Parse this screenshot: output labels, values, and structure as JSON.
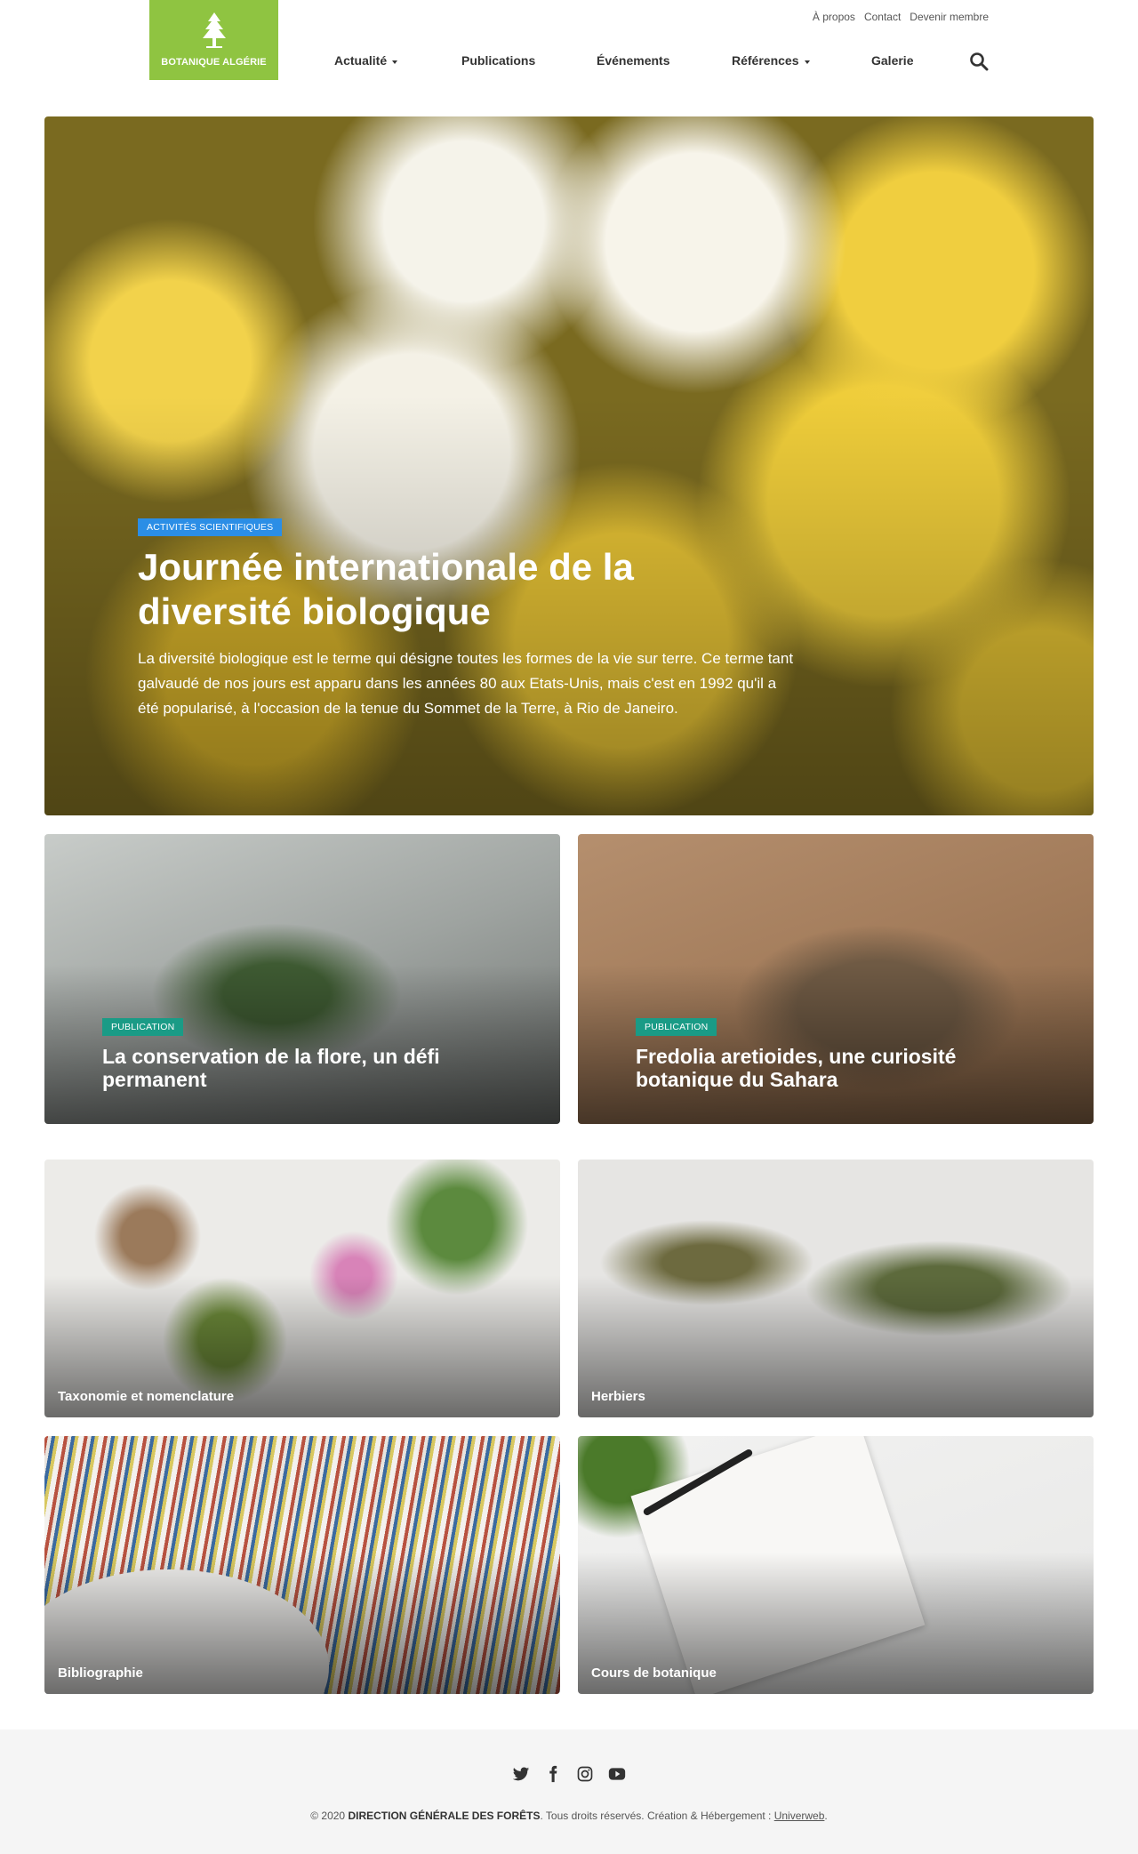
{
  "header": {
    "logo_text": "BOTANIQUE ALGÉRIE",
    "top_links": [
      "À propos",
      "Contact",
      "Devenir membre"
    ],
    "nav": [
      {
        "label": "Actualité",
        "dropdown": true
      },
      {
        "label": "Publications",
        "dropdown": false
      },
      {
        "label": "Événements",
        "dropdown": false
      },
      {
        "label": "Références",
        "dropdown": true
      },
      {
        "label": "Galerie",
        "dropdown": false
      }
    ]
  },
  "hero": {
    "badge": "ACTIVITÉS SCIENTIFIQUES",
    "title": "Journée internationale de la diversité biologique",
    "text": "La diversité biologique est le terme qui désigne toutes les formes de la vie sur terre. Ce terme tant galvaudé de nos jours est apparu dans les années 80 aux Etats-Unis, mais c'est en 1992 qu'il a été popularisé, à l'occasion de la tenue du Sommet de la Terre, à Rio de Janeiro."
  },
  "featured": [
    {
      "badge": "PUBLICATION",
      "title": "La conservation de la flore, un défi permanent"
    },
    {
      "badge": "PUBLICATION",
      "title": "Fredolia aretioides, une curiosité botanique du Sahara"
    }
  ],
  "categories": [
    "Taxonomie et nomenclature",
    "Herbiers",
    "Bibliographie",
    "Cours de botanique"
  ],
  "footer": {
    "social_icons": [
      "twitter-icon",
      "facebook-icon",
      "instagram-icon",
      "youtube-icon"
    ],
    "copyright_prefix": "© 2020",
    "copyright_org": "DIRECTION GÉNÉRALE DES FORÊTS",
    "copyright_middle": ". Tous droits réservés. Création & Hébergement :",
    "copyright_link": "Univerweb",
    "copyright_suffix": "."
  },
  "colors": {
    "brand": "#8fc441",
    "badge_blue": "#2b8ee6",
    "badge_teal": "#1a9b86"
  }
}
